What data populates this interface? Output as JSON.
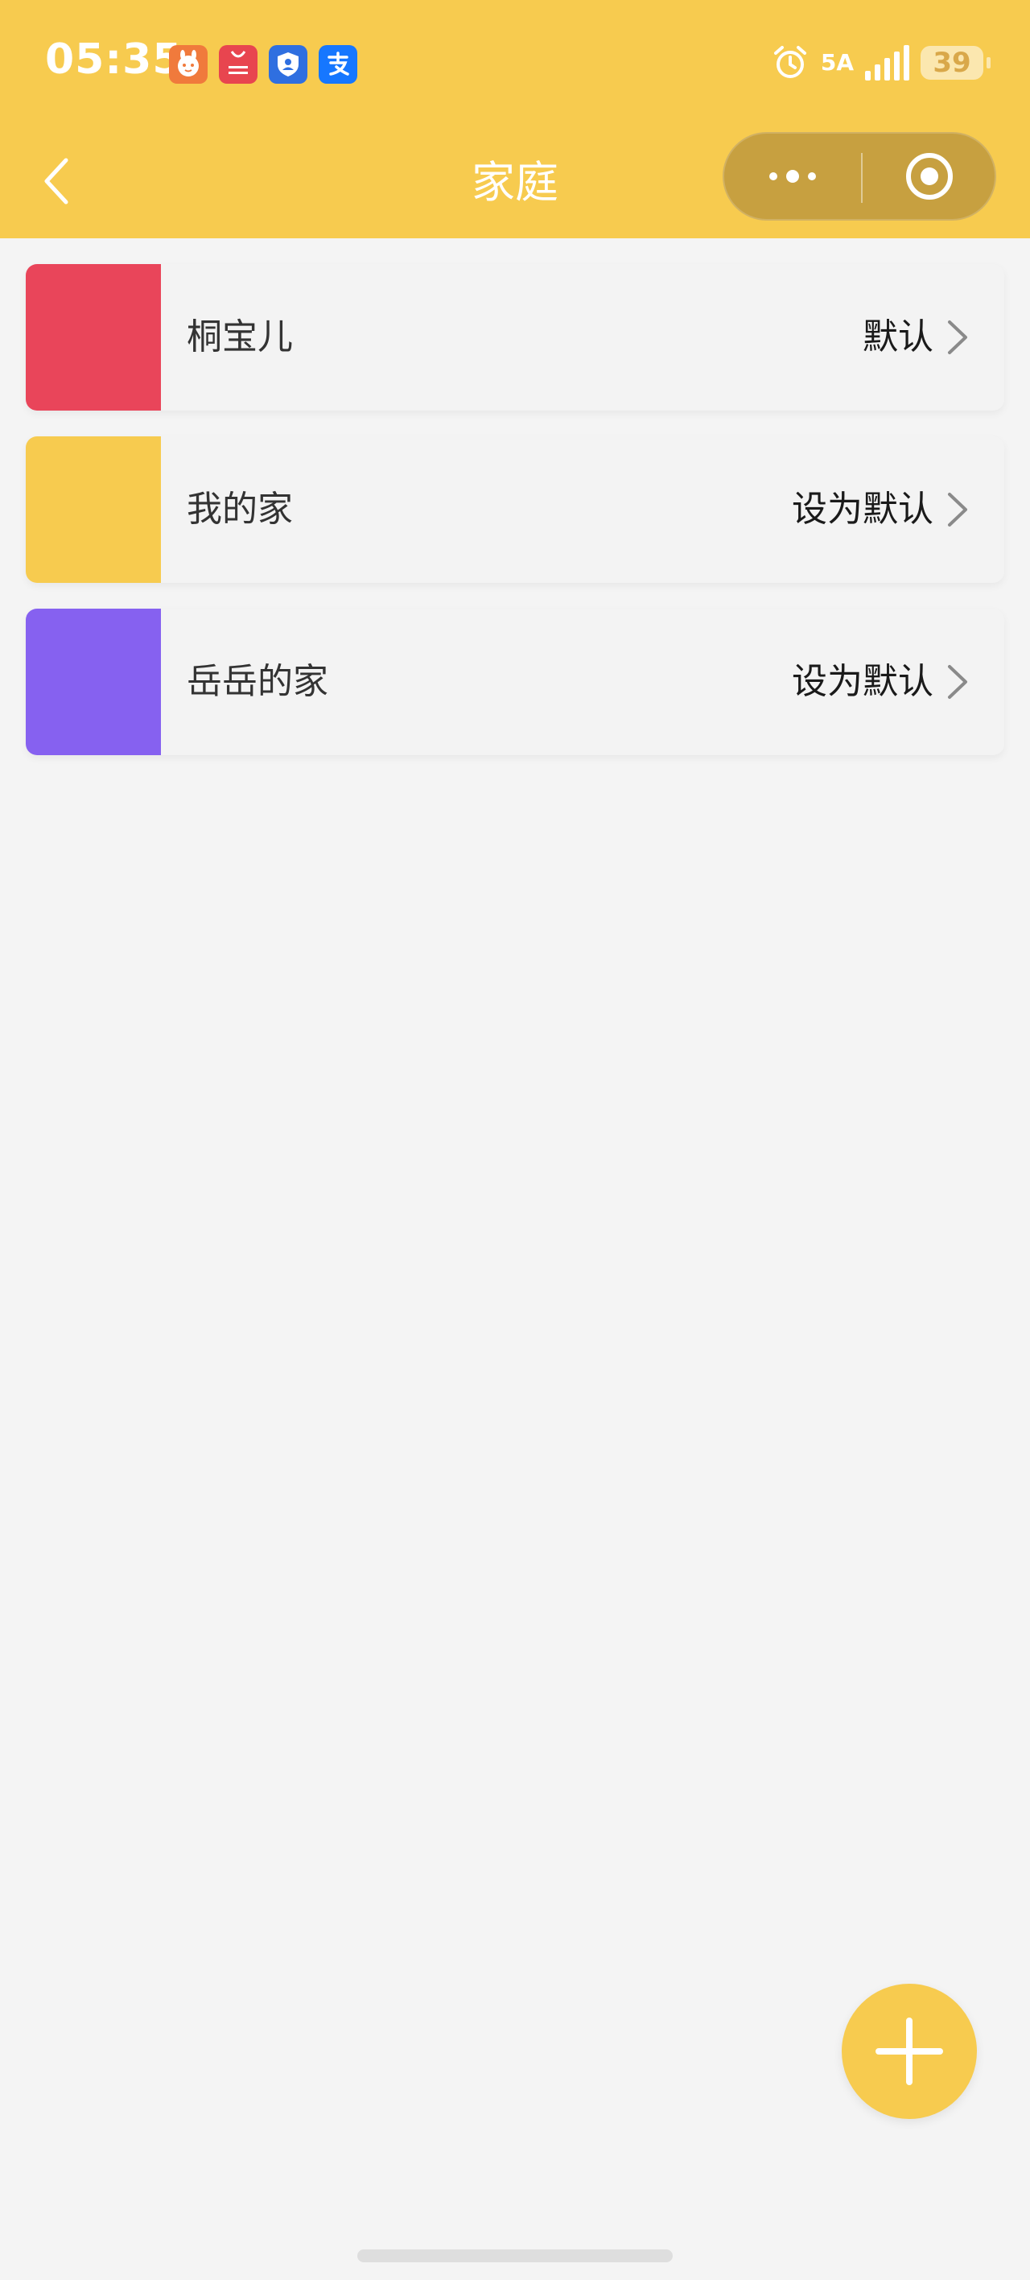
{
  "status_bar": {
    "time": "05:35",
    "network": "5A",
    "battery": "39",
    "app_icons": [
      {
        "name": "bunny-app-icon",
        "color": "#f07a3c",
        "glyph": "•ᴗ•"
      },
      {
        "name": "app-gallery-icon",
        "color": "#e8454f",
        "glyph": "App Gallery"
      },
      {
        "name": "shield-app-icon",
        "color": "#2f6fe0",
        "glyph": "⛨"
      },
      {
        "name": "alipay-icon",
        "color": "#1677ff",
        "glyph": "支"
      }
    ]
  },
  "nav": {
    "title": "家庭"
  },
  "colors": {
    "brand": "#f7cb4f",
    "capsule": "#c7a040",
    "background": "#f4f4f4"
  },
  "families": [
    {
      "name": "桐宝儿",
      "action": "默认",
      "color": "#e9455a"
    },
    {
      "name": "我的家",
      "action": "设为默认",
      "color": "#f7cb4f"
    },
    {
      "name": "岳岳的家",
      "action": "设为默认",
      "color": "#8661f0"
    }
  ]
}
